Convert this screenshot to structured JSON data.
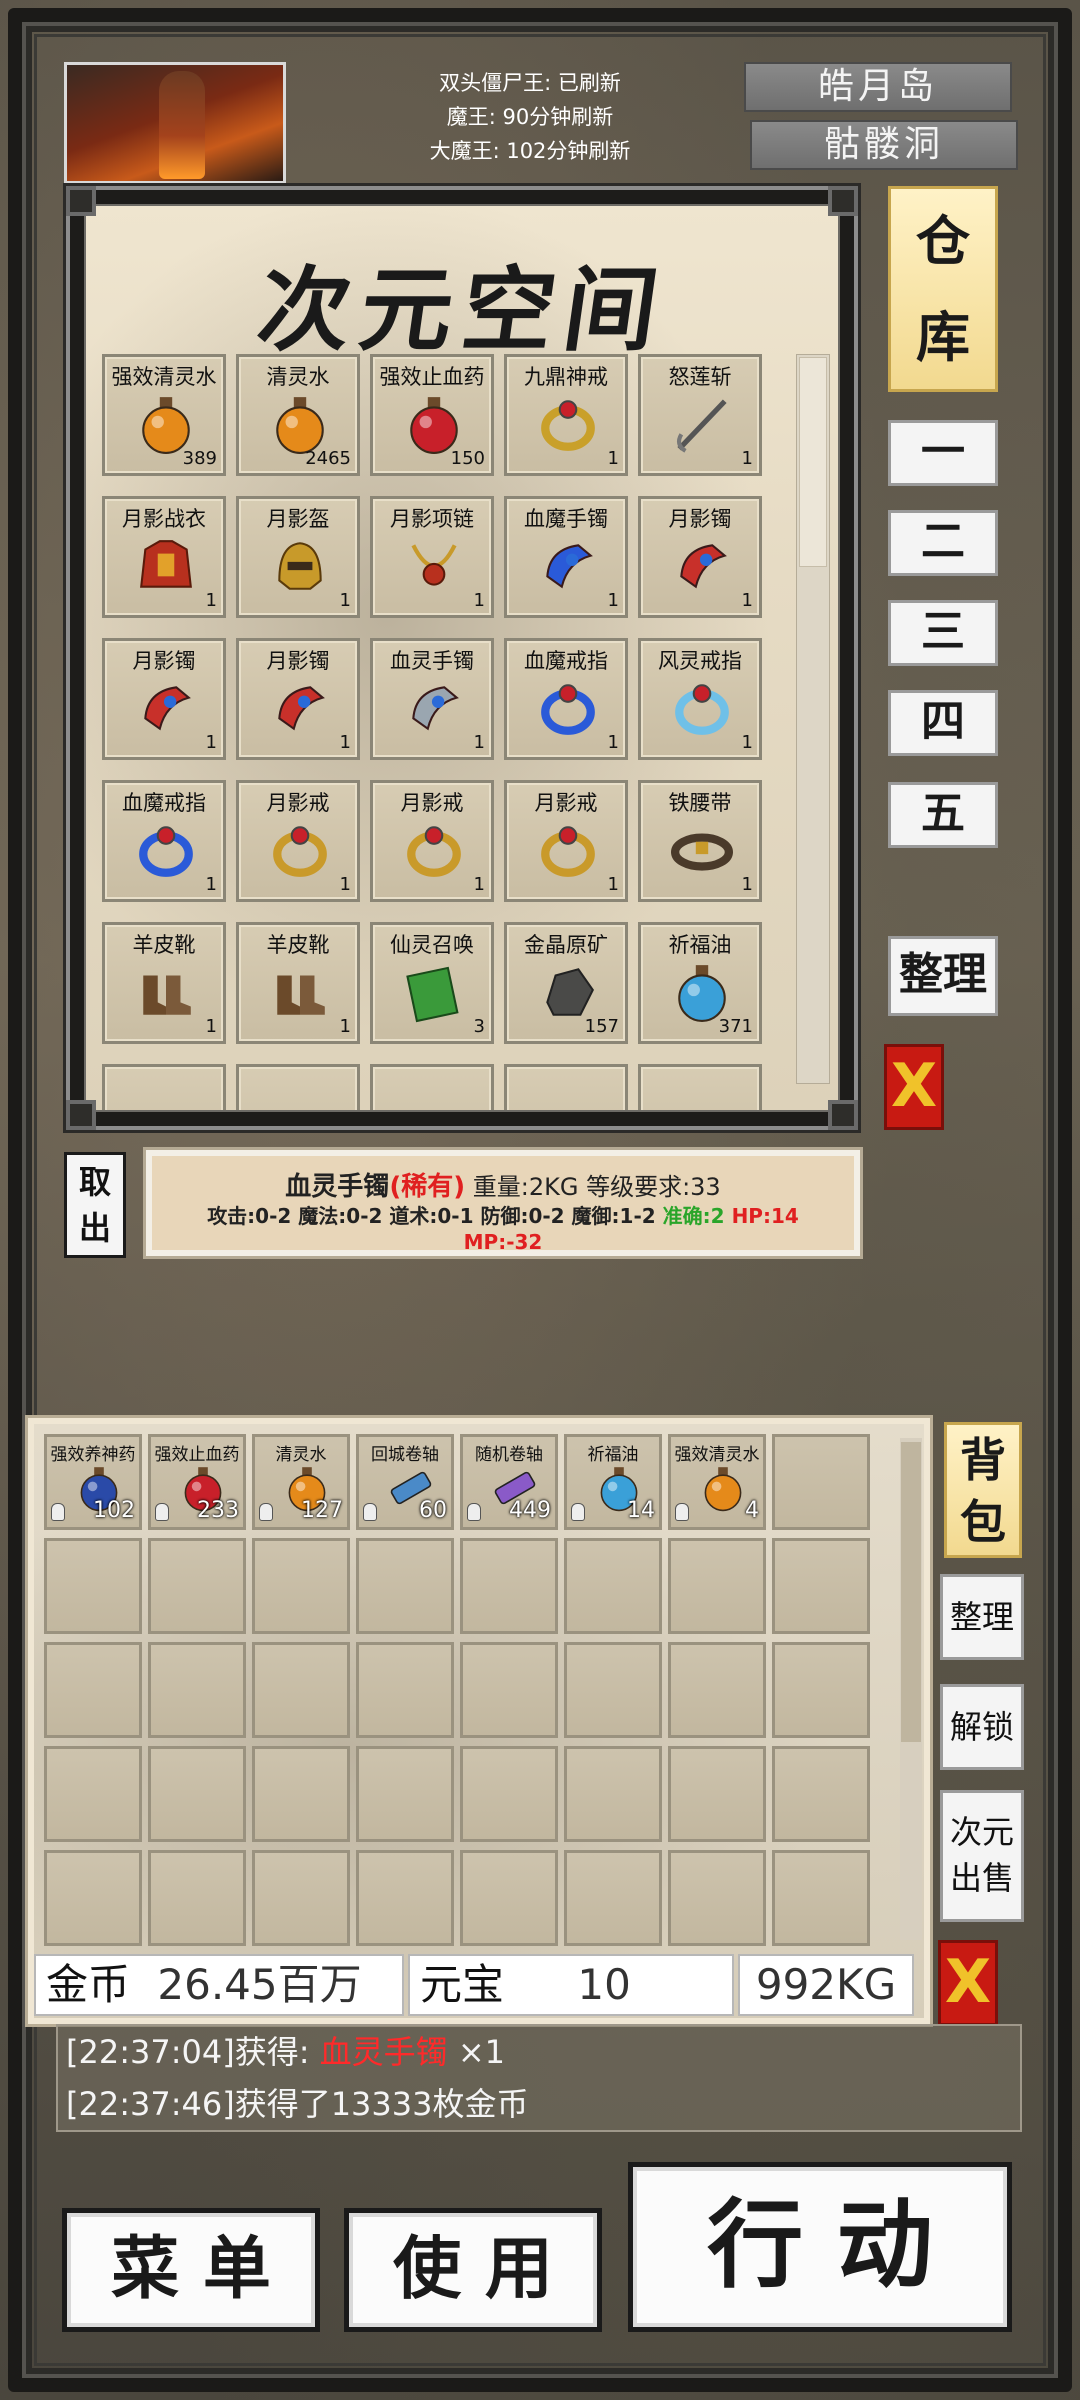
{
  "boss_timers": [
    "双头僵尸王: 已刷新",
    "魔王: 90分钟刷新",
    "大魔王: 102分钟刷新"
  ],
  "locations": [
    "皓月岛",
    "骷髅洞"
  ],
  "storage": {
    "title": "次元空间",
    "side_label": "仓库",
    "pages": [
      "一",
      "二",
      "三",
      "四",
      "五"
    ],
    "sort_label": "整理",
    "close_label": "X",
    "items": [
      {
        "name": "强效清灵水",
        "count": "389"
      },
      {
        "name": "清灵水",
        "count": "2465"
      },
      {
        "name": "强效止血药",
        "count": "150"
      },
      {
        "name": "九鼎神戒",
        "count": "1"
      },
      {
        "name": "怒莲斩",
        "count": "1"
      },
      {
        "name": "月影战衣",
        "count": "1"
      },
      {
        "name": "月影盔",
        "count": "1"
      },
      {
        "name": "月影项链",
        "count": "1"
      },
      {
        "name": "血魔手镯",
        "count": "1"
      },
      {
        "name": "月影镯",
        "count": "1"
      },
      {
        "name": "月影镯",
        "count": "1"
      },
      {
        "name": "月影镯",
        "count": "1"
      },
      {
        "name": "血灵手镯",
        "count": "1"
      },
      {
        "name": "血魔戒指",
        "count": "1"
      },
      {
        "name": "风灵戒指",
        "count": "1"
      },
      {
        "name": "血魔戒指",
        "count": "1"
      },
      {
        "name": "月影戒",
        "count": "1"
      },
      {
        "name": "月影戒",
        "count": "1"
      },
      {
        "name": "月影戒",
        "count": "1"
      },
      {
        "name": "铁腰带",
        "count": "1"
      },
      {
        "name": "羊皮靴",
        "count": "1"
      },
      {
        "name": "羊皮靴",
        "count": "1"
      },
      {
        "name": "仙灵召唤",
        "count": "3"
      },
      {
        "name": "金晶原矿",
        "count": "157"
      },
      {
        "name": "祈福油",
        "count": "371"
      }
    ]
  },
  "takeout_label": "取出",
  "detail": {
    "name": "血灵手镯",
    "rarity": "(稀有)",
    "weight": "重量:2KG",
    "level": "等级要求:33",
    "stats": "攻击:0-2 魔法:0-2 道术:0-1 防御:0-2 魔御:1-2",
    "accuracy": "准确:2",
    "hp": "HP:14",
    "mp": "MP:-32"
  },
  "bag": {
    "side_label": "背包",
    "sort_label": "整理",
    "unlock_label": "解锁",
    "sell_label": "次元出售",
    "close_label": "X",
    "items": [
      {
        "name": "强效养神药",
        "count": "102"
      },
      {
        "name": "强效止血药",
        "count": "233"
      },
      {
        "name": "清灵水",
        "count": "127"
      },
      {
        "name": "回城卷轴",
        "count": "60"
      },
      {
        "name": "随机卷轴",
        "count": "449"
      },
      {
        "name": "祈福油",
        "count": "14"
      },
      {
        "name": "强效清灵水",
        "count": "4"
      }
    ],
    "gold_label": "金币",
    "gold_value": "26.45百万",
    "yuanbao_label": "元宝",
    "yuanbao_value": "10",
    "weight": "992KG"
  },
  "log": {
    "line1_prefix": "[22:37:04]获得: ",
    "line1_item": "血灵手镯",
    "line1_suffix": " ×1",
    "line2": "[22:37:46]获得了13333枚金币"
  },
  "buttons": {
    "menu": "菜 单",
    "use": "使 用",
    "action": "行 动"
  },
  "colors": {
    "rare_red": "#e02020",
    "accuracy_green": "#2aa52a",
    "hp_red": "#e02020",
    "tab_gold": "#f2d98f",
    "close_red": "#c81a12"
  }
}
